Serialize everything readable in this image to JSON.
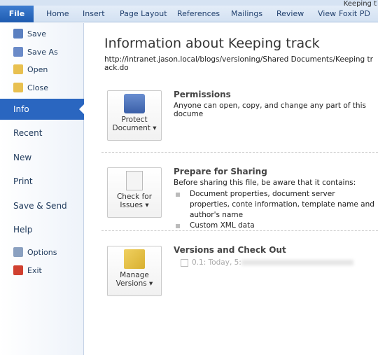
{
  "window": {
    "title": "Keeping t"
  },
  "ribbon": {
    "file": "File",
    "tabs": [
      "Home",
      "Insert",
      "Page Layout",
      "References",
      "Mailings",
      "Review",
      "View",
      "Foxit PD"
    ]
  },
  "sidebar": {
    "items": [
      {
        "label": "Save",
        "icon": "save-icon"
      },
      {
        "label": "Save As",
        "icon": "save-as-icon"
      },
      {
        "label": "Open",
        "icon": "open-folder-icon"
      },
      {
        "label": "Close",
        "icon": "close-folder-icon"
      },
      {
        "label": "Info"
      },
      {
        "label": "Recent"
      },
      {
        "label": "New"
      },
      {
        "label": "Print"
      },
      {
        "label": "Save & Send"
      },
      {
        "label": "Help"
      },
      {
        "label": "Options",
        "icon": "options-icon"
      },
      {
        "label": "Exit",
        "icon": "exit-icon"
      }
    ]
  },
  "main": {
    "title": "Information about Keeping track",
    "path": "http://intranet.jason.local/blogs/versioning/Shared Documents/Keeping track.do",
    "permissions": {
      "button": [
        "Protect",
        "Document ▾"
      ],
      "heading": "Permissions",
      "text": "Anyone can open, copy, and change any part of this docume"
    },
    "sharing": {
      "button": [
        "Check for",
        "Issues ▾"
      ],
      "heading": "Prepare for Sharing",
      "text": "Before sharing this file, be aware that it contains:",
      "bullets": [
        "Document properties, document server properties, conte",
        "information, template name and author's name",
        "Custom XML data"
      ]
    },
    "versions": {
      "button": [
        "Manage",
        "Versions ▾"
      ],
      "heading": "Versions and Check Out",
      "entry": "0.1: Today, 5:"
    }
  }
}
